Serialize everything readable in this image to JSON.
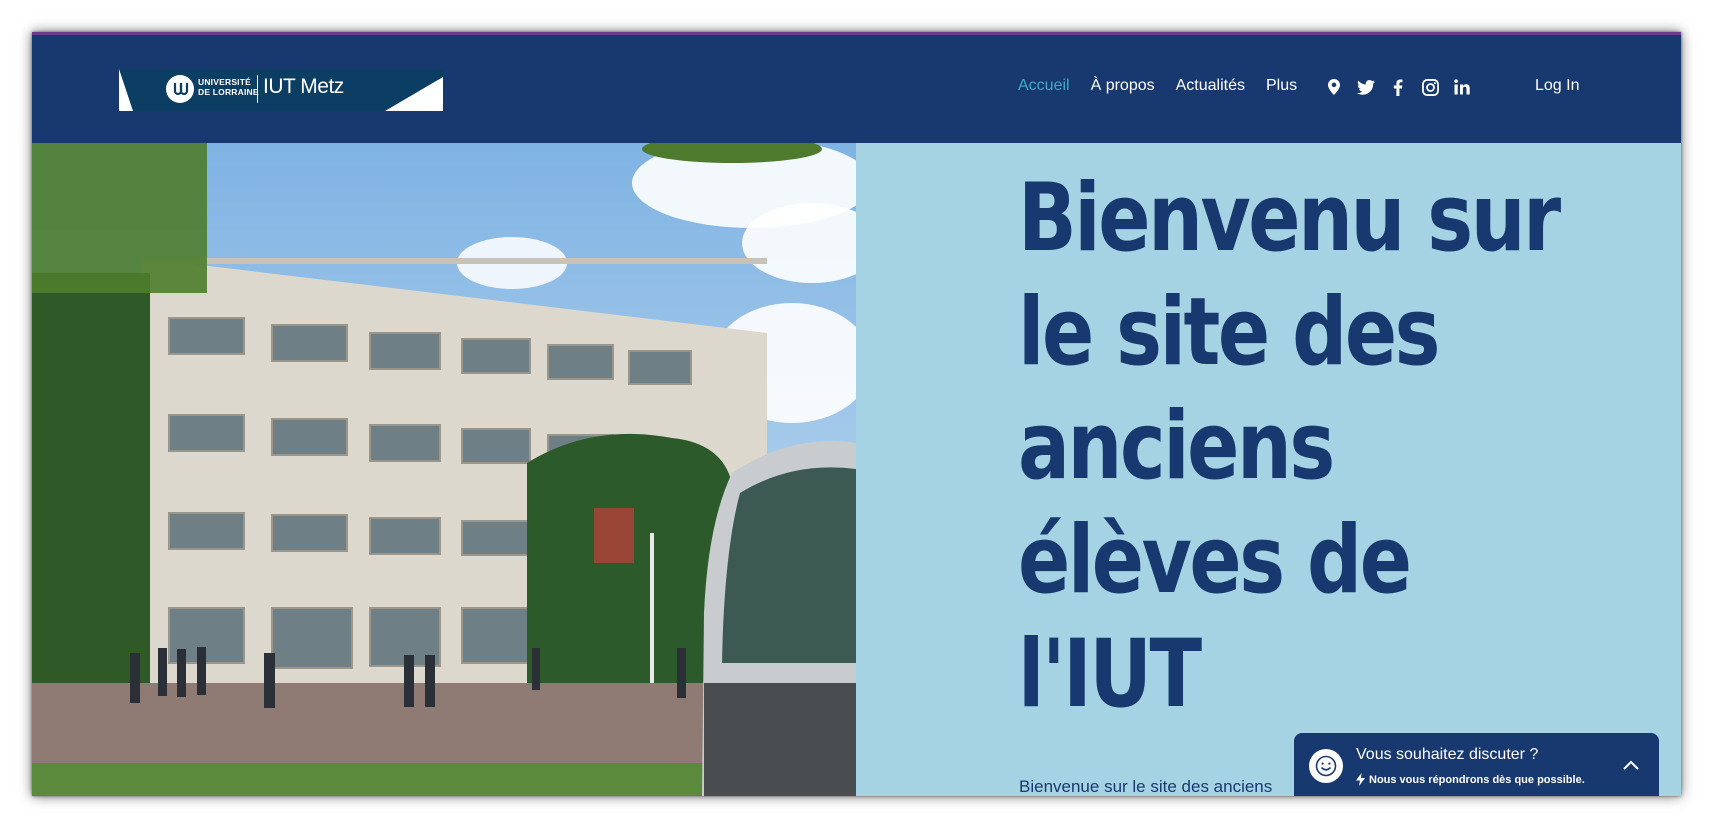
{
  "header": {
    "logo": {
      "university_line1": "UNIVERSITÉ",
      "university_line2": "DE LORRAINE",
      "iut_text": "IUT Metz"
    },
    "nav": [
      {
        "label": "Accueil",
        "active": true
      },
      {
        "label": "À propos",
        "active": false
      },
      {
        "label": "Actualités",
        "active": false
      },
      {
        "label": "Plus",
        "active": false
      }
    ],
    "social_icons": [
      "location-pin-icon",
      "twitter-icon",
      "facebook-icon",
      "instagram-icon",
      "linkedin-icon"
    ],
    "login_label": "Log In"
  },
  "hero": {
    "title_lines": [
      "Bienvenu sur",
      "le site des",
      "anciens",
      "élèves de",
      "l'IUT"
    ],
    "subtitle": "Bienvenue sur le site des anciens"
  },
  "chat_widget": {
    "title": "Vous souhaitez discuter ?",
    "subtitle": "Nous vous répondrons dès que possible."
  },
  "colors": {
    "header_bg": "#18396f",
    "hero_bg": "#a5d3e3",
    "nav_active": "#3ea9c9",
    "text_dark": "#18396f"
  }
}
